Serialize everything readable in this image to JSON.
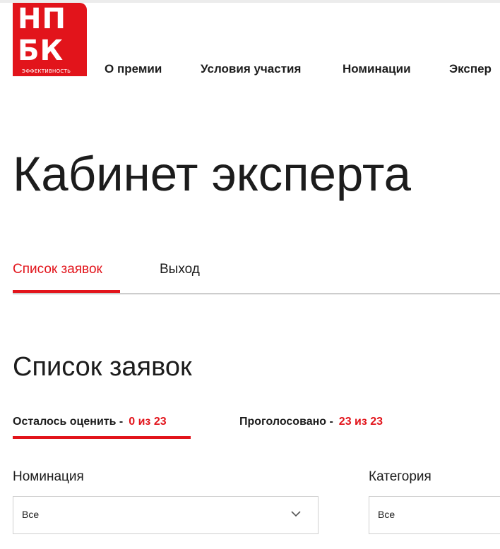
{
  "logo": {
    "line1": "НП",
    "line2": "БК",
    "subtitle": "ЭФФЕКТИВНОСТЬ",
    "color": "#e2141b"
  },
  "nav": {
    "items": [
      {
        "label": "О премии"
      },
      {
        "label": "Условия участия"
      },
      {
        "label": "Номинации"
      },
      {
        "label": "Экспер"
      }
    ]
  },
  "page": {
    "title": "Кабинет эксперта"
  },
  "tabs": [
    {
      "label": "Список заявок",
      "active": true
    },
    {
      "label": "Выход",
      "active": false
    }
  ],
  "section": {
    "title": "Список заявок",
    "filters": [
      {
        "label": "Осталось оценить -",
        "count": "0 из 23",
        "active": true
      },
      {
        "label": "Проголосовано -",
        "count": "23 из 23",
        "active": false
      }
    ]
  },
  "fields": {
    "nomination": {
      "label": "Номинация",
      "value": "Все"
    },
    "category": {
      "label": "Категория",
      "value": "Все"
    }
  },
  "colors": {
    "accent": "#e2141b",
    "text": "#1c1c1c"
  },
  "icons": {
    "dropdown": "chevron-down-icon"
  }
}
